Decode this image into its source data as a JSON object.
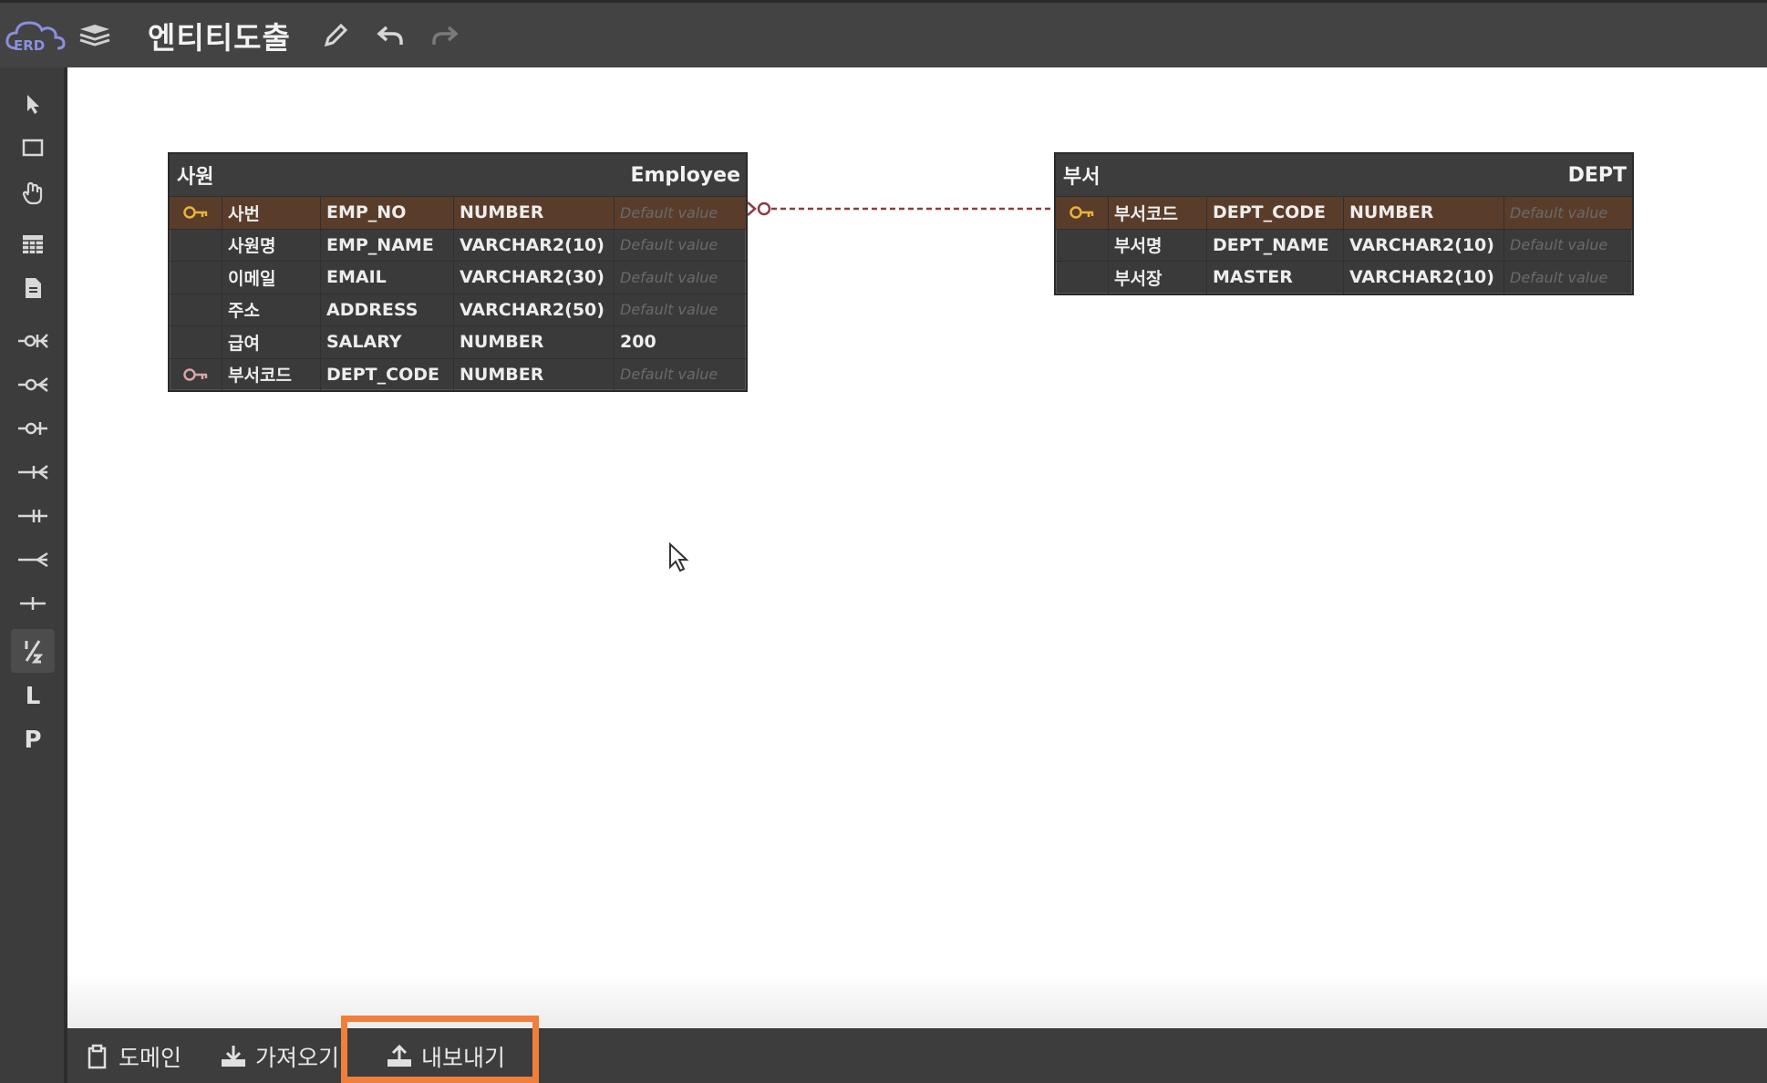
{
  "app": {
    "logo_text": "ERD",
    "title": "엔티티도출"
  },
  "toolbar": {
    "buttons": [
      "layers-icon",
      "pencil-icon",
      "undo-icon",
      "redo-icon"
    ]
  },
  "tools": [
    {
      "name": "pointer-icon"
    },
    {
      "name": "select-rect-icon"
    },
    {
      "name": "hand-icon"
    },
    {
      "name": "table-icon"
    },
    {
      "name": "memo-icon"
    },
    {
      "name": "zero-one-many-icon"
    },
    {
      "name": "zero-many-icon"
    },
    {
      "name": "zero-one-icon"
    },
    {
      "name": "one-many-icon"
    },
    {
      "name": "one-only-icon"
    },
    {
      "name": "many-icon"
    },
    {
      "name": "one-icon"
    },
    {
      "name": "fraction-icon",
      "active": true
    },
    {
      "label": "L"
    },
    {
      "label": "P"
    }
  ],
  "tables": {
    "employee": {
      "logical_name": "사원",
      "physical_name": "Employee",
      "columns": [
        {
          "key": "pk",
          "logical": "사번",
          "physical": "EMP_NO",
          "type": "NUMBER",
          "default": "Default value",
          "default_is_placeholder": true
        },
        {
          "key": "",
          "logical": "사원명",
          "physical": "EMP_NAME",
          "type": "VARCHAR2(10)",
          "default": "Default value",
          "default_is_placeholder": true
        },
        {
          "key": "",
          "logical": "이메일",
          "physical": "EMAIL",
          "type": "VARCHAR2(30)",
          "default": "Default value",
          "default_is_placeholder": true
        },
        {
          "key": "",
          "logical": "주소",
          "physical": "ADDRESS",
          "type": "VARCHAR2(50)",
          "default": "Default value",
          "default_is_placeholder": true
        },
        {
          "key": "",
          "logical": "급여",
          "physical": "SALARY",
          "type": "NUMBER",
          "default": "200",
          "default_is_placeholder": false
        },
        {
          "key": "fk",
          "logical": "부서코드",
          "physical": "DEPT_CODE",
          "type": "NUMBER",
          "default": "Default value",
          "default_is_placeholder": true
        }
      ]
    },
    "dept": {
      "logical_name": "부서",
      "physical_name": "DEPT",
      "columns": [
        {
          "key": "pk",
          "logical": "부서코드",
          "physical": "DEPT_CODE",
          "type": "NUMBER",
          "default": "Default value",
          "default_is_placeholder": true
        },
        {
          "key": "",
          "logical": "부서명",
          "physical": "DEPT_NAME",
          "type": "VARCHAR2(10)",
          "default": "Default value",
          "default_is_placeholder": true
        },
        {
          "key": "",
          "logical": "부서장",
          "physical": "MASTER",
          "type": "VARCHAR2(10)",
          "default": "Default value",
          "default_is_placeholder": true
        }
      ]
    }
  },
  "relationship": {
    "from": "employee",
    "to": "dept",
    "style": "dashed",
    "from_end": "zero-many",
    "to_end": "one-only"
  },
  "colors": {
    "accent": "#f07f3a",
    "pk_row": "#5a3c2b",
    "key_pk": "#e7b43a",
    "key_fk": "#d9a3a8",
    "relation": "#8c3b44"
  },
  "bottom": {
    "domain_label": "도메인",
    "import_label": "가져오기",
    "export_label": "내보내기"
  }
}
